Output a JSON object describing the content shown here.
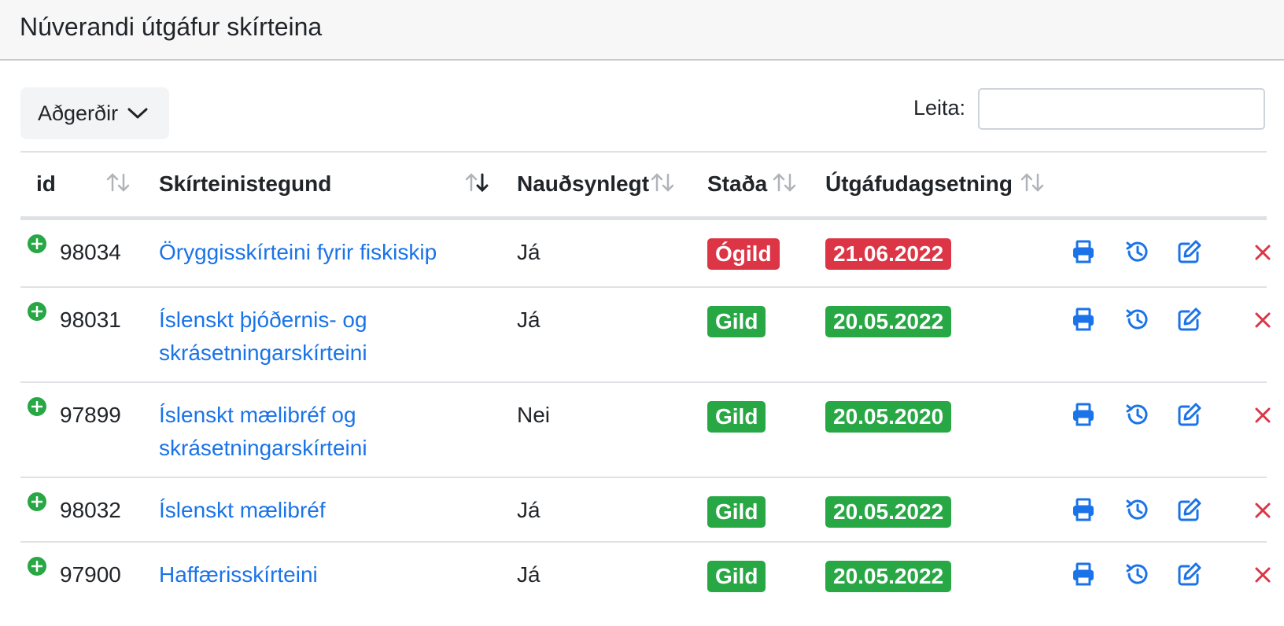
{
  "header": {
    "title": "Núverandi útgáfur skírteina"
  },
  "toolbar": {
    "actions_label": "Aðgerðir",
    "search_label": "Leita:",
    "search_value": "",
    "search_placeholder": ""
  },
  "table": {
    "columns": [
      {
        "key": "id",
        "label": "id"
      },
      {
        "key": "type",
        "label": "Skírteinistegund"
      },
      {
        "key": "required",
        "label": "Nauðsynlegt"
      },
      {
        "key": "status",
        "label": "Staða"
      },
      {
        "key": "issue_date",
        "label": "Útgáfudagsetning"
      }
    ],
    "rows": [
      {
        "id": "98034",
        "type": "Öryggisskírteini fyrir fiskiskip",
        "required": "Já",
        "status": "Ógild",
        "status_color": "#dc3545",
        "issue_date": "21.06.2022",
        "date_color": "#dc3545"
      },
      {
        "id": "98031",
        "type": "Íslenskt þjóðernis- og skrásetningarskírteini",
        "required": "Já",
        "status": "Gild",
        "status_color": "#28a745",
        "issue_date": "20.05.2022",
        "date_color": "#28a745"
      },
      {
        "id": "97899",
        "type": "Íslenskt mælibréf og skrásetningarskírteini",
        "required": "Nei",
        "status": "Gild",
        "status_color": "#28a745",
        "issue_date": "20.05.2020",
        "date_color": "#28a745"
      },
      {
        "id": "98032",
        "type": "Íslenskt mælibréf",
        "required": "Já",
        "status": "Gild",
        "status_color": "#28a745",
        "issue_date": "20.05.2022",
        "date_color": "#28a745"
      },
      {
        "id": "97900",
        "type": "Haffærisskírteini",
        "required": "Já",
        "status": "Gild",
        "status_color": "#28a745",
        "issue_date": "20.05.2022",
        "date_color": "#28a745"
      }
    ],
    "row_actions": [
      "printer-icon",
      "history-icon",
      "edit-icon",
      "close-icon"
    ]
  },
  "colors": {
    "link": "#1a73e8",
    "danger": "#dc3545",
    "success": "#28a745",
    "expand": "#28a745"
  }
}
